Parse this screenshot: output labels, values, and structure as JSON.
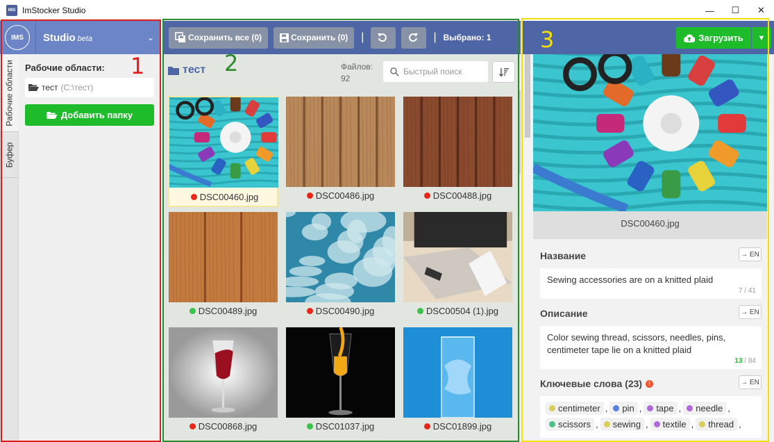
{
  "window": {
    "title": "ImStocker Studio",
    "logo_text": "IMS"
  },
  "left": {
    "badge": "IMS",
    "studio": "Studio",
    "beta": "beta",
    "tabs": [
      "Рабочие области",
      "Буфер"
    ],
    "workspaces_label": "Рабочие области:",
    "workspace": {
      "name": "тест",
      "path": "(C:\\тест)"
    },
    "add_folder": "Добавить папку"
  },
  "mid": {
    "save_all": "Сохранить все (0)",
    "save": "Сохранить (0)",
    "selected": "Выбрано: 1",
    "folder": "тест",
    "files_label": "Файлов:",
    "files_count": "92",
    "search_placeholder": "Быстрый поиск",
    "files": [
      {
        "name": "DSC00460.jpg",
        "status": "#e8271b",
        "thumb": "sewing"
      },
      {
        "name": "DSC00486.jpg",
        "status": "#e8271b",
        "thumb": "wood1"
      },
      {
        "name": "DSC00488.jpg",
        "status": "#e8271b",
        "thumb": "wood2"
      },
      {
        "name": "DSC00489.jpg",
        "status": "#3cc04a",
        "thumb": "wood3"
      },
      {
        "name": "DSC00490.jpg",
        "status": "#e8271b",
        "thumb": "blue-paint"
      },
      {
        "name": "DSC00504 (1).jpg",
        "status": "#3cc04a",
        "thumb": "desk"
      },
      {
        "name": "DSC00868.jpg",
        "status": "#e8271b",
        "thumb": "wine"
      },
      {
        "name": "DSC01037.jpg",
        "status": "#3cc04a",
        "thumb": "juice"
      },
      {
        "name": "DSC01899.jpg",
        "status": "#e8271b",
        "thumb": "water"
      }
    ]
  },
  "right": {
    "upload": "Загрузить",
    "preview_name": "DSC00460.jpg",
    "title_label": "Название",
    "title_value": "Sewing accessories are on a knitted plaid",
    "title_counter": "7 / 41",
    "desc_label": "Описание",
    "desc_value": "Color sewing thread, scissors, needles, pins, centimeter tape lie on a knitted plaid",
    "desc_counter_a": "13",
    "desc_counter_b": " / 84",
    "kw_label": "Ключевые слова (23)",
    "en": "→ EN",
    "keywords": [
      {
        "word": "centimeter",
        "color": "#d8cf5a"
      },
      {
        "word": "pin",
        "color": "#5a7fe0"
      },
      {
        "word": "tape",
        "color": "#b06ad8"
      },
      {
        "word": "needle",
        "color": "#b06ad8"
      },
      {
        "word": "scissors",
        "color": "#4cc28a"
      },
      {
        "word": "sewing",
        "color": "#d8cf5a"
      },
      {
        "word": "textile",
        "color": "#b06ad8"
      },
      {
        "word": "thread",
        "color": "#d8cf5a"
      }
    ]
  },
  "overlay": {
    "n1": "1",
    "n2": "2",
    "n3": "3",
    "c1": "#e01b1b",
    "c2": "#2b8a2b",
    "c3": "#f3e000"
  }
}
